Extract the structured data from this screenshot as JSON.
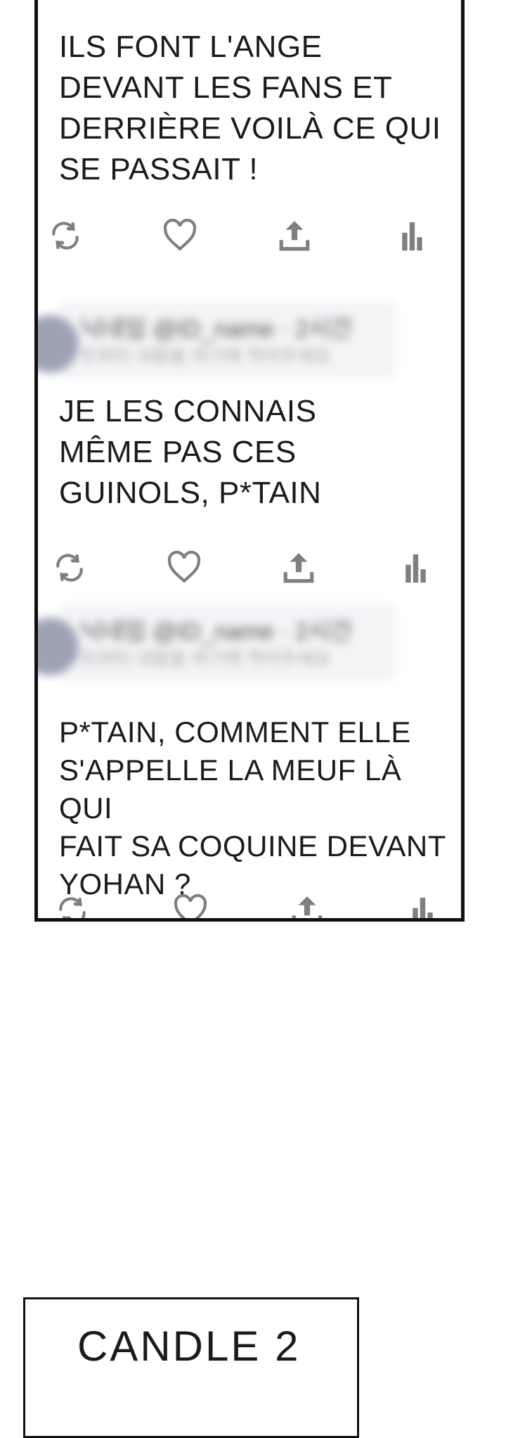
{
  "tweets": [
    {
      "text": "ILS FONT L'ANGE\nDEVANT LES FANS ET\nDERRIÈRE VOILÀ CE QUI\nSE PASSAIT !"
    },
    {
      "header_name": "닉네임 @ID_name · 2시간",
      "header_sub": "트위터 내용을 여기에 적어주세요",
      "text": "JE LES CONNAIS\nMÊME PAS CES\nGUINOLS, P*TAIN"
    },
    {
      "header_name": "닉네임 @ID_name · 2시간",
      "header_sub": "트위터 내용을 여기에 적어주세요",
      "text": "P*TAIN, COMMENT ELLE\nS'APPELLE LA MEUF LÀ QUI\nFAIT SA COQUINE DEVANT\nYOHAN ?"
    }
  ],
  "icons": {
    "retweet": "retweet-icon",
    "like": "heart-icon",
    "share": "share-icon",
    "stats": "bar-chart-icon"
  },
  "colors": {
    "icon": "#7f7f7f",
    "frame": "#111111",
    "text": "#1b1b1b"
  },
  "bottom_panel": {
    "title": "CANDLE 2"
  }
}
